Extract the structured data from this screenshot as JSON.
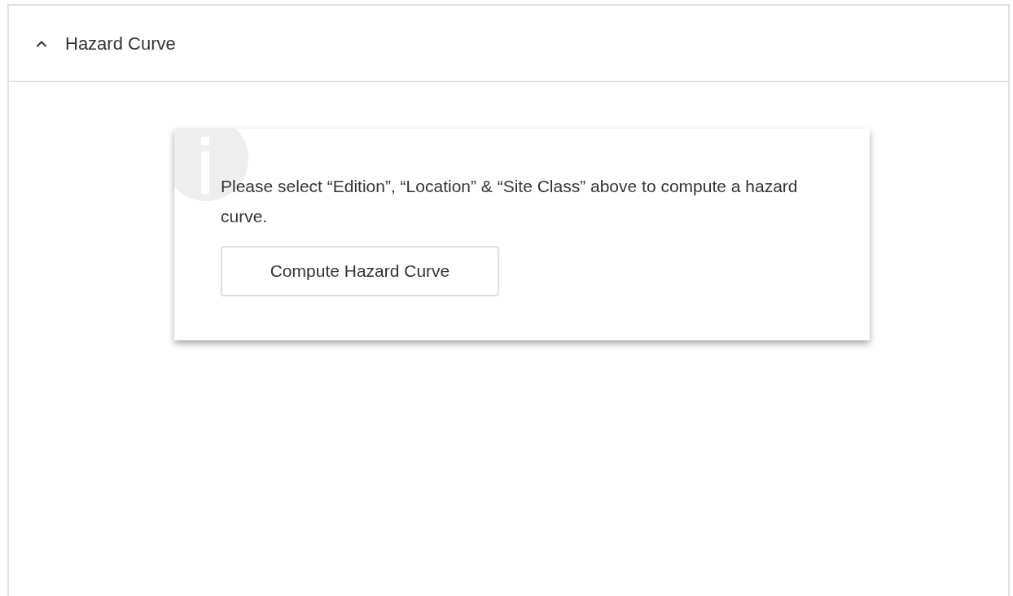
{
  "panel": {
    "title": "Hazard Curve",
    "expanded": true
  },
  "alert": {
    "message": "Please select “Edition”, “Location” & “Site Class” above to compute a hazard curve.",
    "button": "Compute Hazard Curve"
  }
}
